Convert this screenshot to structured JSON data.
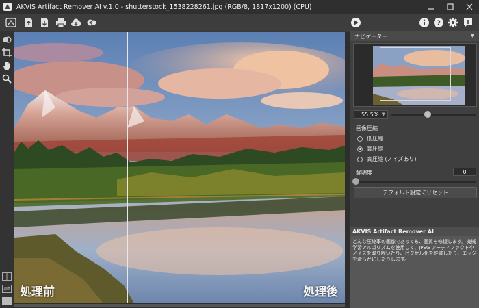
{
  "window": {
    "title": "AKVIS Artifact Remover AI v.1.0 - shutterstock_1538228261.jpg (RGB/8, 1817x1200) (CPU)",
    "controls": [
      "minimize",
      "maximize",
      "close"
    ]
  },
  "toolbar": {
    "left_icons": [
      "logo-icon",
      "open-icon",
      "save-icon",
      "print-icon",
      "share-icon",
      "plugins-icon"
    ],
    "right_icons": [
      "run-icon",
      "info-icon",
      "help-icon",
      "settings-icon",
      "news-icon"
    ]
  },
  "tools": [
    "before-after-tool",
    "crop-tool",
    "hand-tool",
    "zoom-tool"
  ],
  "canvas": {
    "before_label": "処理前",
    "after_label": "処理後"
  },
  "navigator": {
    "title": "ナビゲーター",
    "zoom_value": "55.5%",
    "zoom_level": 0.45
  },
  "settings": {
    "compression_title": "画像圧縮",
    "options": [
      "低圧縮",
      "高圧縮",
      "高圧縮 (ノイズあり)"
    ],
    "selected_option": 1,
    "sharpness_label": "鮮明度",
    "sharpness_value": "0",
    "reset_label": "デフォルト設定にリセット"
  },
  "help": {
    "title": "AKVIS Artifact Remover AI",
    "text": "どんな圧縮率の画像であっても、画質を修復します。機械学習アルゴリズムを使用して、JPEG アーティファクトやノイズを取り除いたり、ピクセル化を軽減したり、エッジを滑らかにしたりします。"
  },
  "colors": {
    "panel_bg": "#3f3f3f",
    "titlebar_bg": "#2f2f2f",
    "accent": "#d8d8d8"
  }
}
